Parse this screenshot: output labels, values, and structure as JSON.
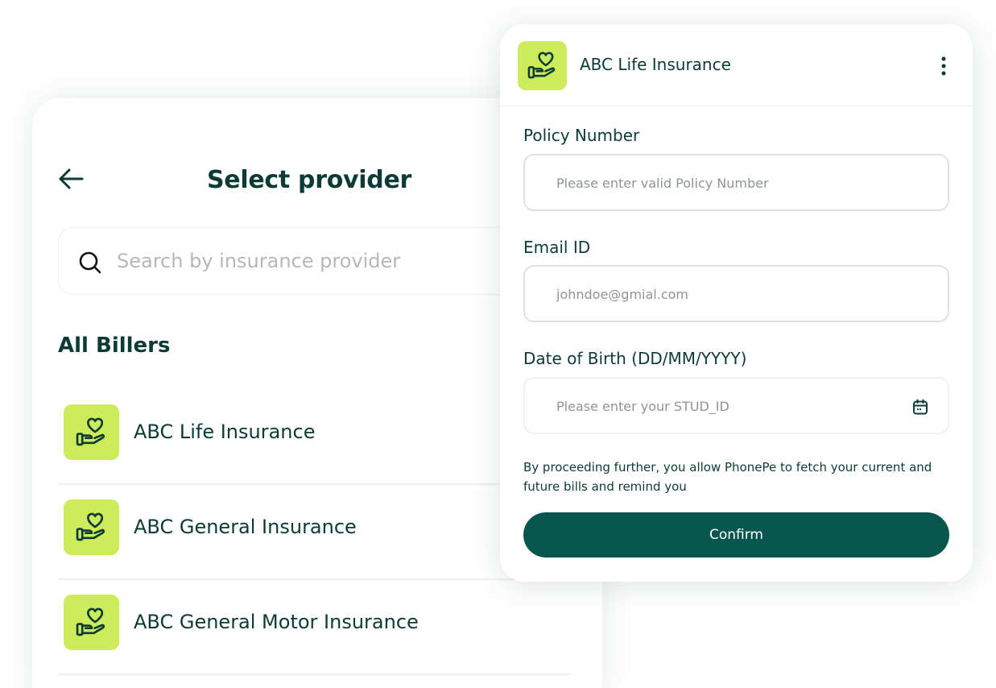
{
  "colors": {
    "brand_dark": "#07554f",
    "text_primary": "#0c3b36",
    "icon_bg": "#cdeb5a",
    "placeholder": "#b4b8b6"
  },
  "provider_screen": {
    "back_icon": "arrow-left-icon",
    "title": "Select provider",
    "search": {
      "icon": "search-icon",
      "placeholder": "Search by insurance provider",
      "value": ""
    },
    "section_title": "All Billers",
    "billers": [
      {
        "name": "ABC Life Insurance",
        "icon": "hand-heart-icon"
      },
      {
        "name": "ABC General Insurance",
        "icon": "hand-heart-icon"
      },
      {
        "name": "ABC General Motor Insurance",
        "icon": "hand-heart-icon"
      }
    ]
  },
  "form_card": {
    "header": {
      "logo_icon": "hand-heart-icon",
      "title": "ABC Life Insurance",
      "menu_icon": "kebab-menu-icon"
    },
    "fields": {
      "policy": {
        "label": "Policy Number",
        "placeholder": "Please enter valid Policy Number",
        "value": ""
      },
      "email": {
        "label": "Email ID",
        "placeholder": "johndoe@gmial.com",
        "value": ""
      },
      "dob": {
        "label": "Date of Birth (DD/MM/YYYY)",
        "placeholder": "Please enter your STUD_ID",
        "value": "",
        "icon": "calendar-icon"
      }
    },
    "consent_text": "By proceeding further, you allow PhonePe to fetch your current and future bills and remind you",
    "confirm_label": "Confirm"
  }
}
